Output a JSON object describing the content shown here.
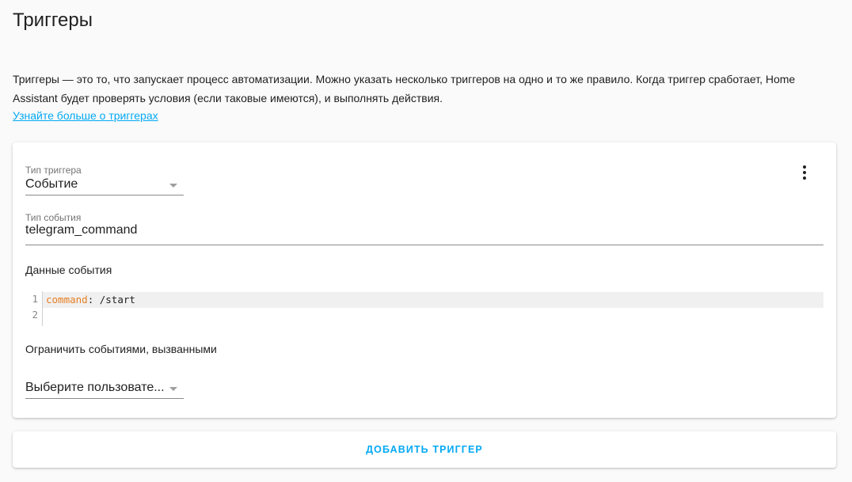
{
  "page": {
    "title": "Триггеры",
    "intro": "Триггеры — это то, что запускает процесс автоматизации. Можно указать несколько триггеров на одно и то же правило. Когда триггер сработает, Home Assistant будет проверять условия (если таковые имеются), и выполнять действия.",
    "learn_more": "Узнайте больше о триггерах"
  },
  "trigger": {
    "type_label": "Тип триггера",
    "type_value": "Событие",
    "event_type_label": "Тип события",
    "event_type_value": "telegram_command",
    "event_data_label": "Данные события",
    "code": {
      "line_numbers": [
        "1",
        "2"
      ],
      "key": "command",
      "separator": ": ",
      "value": "/start"
    },
    "limit_label": "Ограничить событиями, вызванными",
    "user_select_value": "Выберите пользовате..."
  },
  "actions": {
    "add_trigger": "ДОБАВИТЬ ТРИГГЕР"
  },
  "icons": {
    "menu": "dots-vertical-icon",
    "dropdown": "triangle-down-icon"
  },
  "colors": {
    "accent": "#03a9f4",
    "yaml_key": "#e67e22",
    "background": "#fafafa"
  }
}
